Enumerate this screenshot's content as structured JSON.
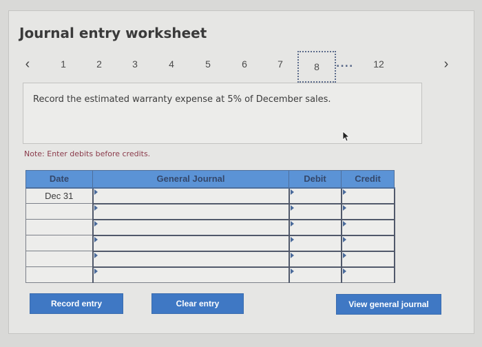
{
  "title": "Journal entry worksheet",
  "pager": {
    "prev_icon": "‹",
    "next_icon": "›",
    "pages": [
      "1",
      "2",
      "3",
      "4",
      "5",
      "6",
      "7",
      "8"
    ],
    "active_page": "8",
    "ellipsis": "....",
    "last_page": "12"
  },
  "prompt": "Record the estimated warranty expense at 5% of December sales.",
  "note": "Note: Enter debits before credits.",
  "table": {
    "headers": {
      "date": "Date",
      "journal": "General Journal",
      "debit": "Debit",
      "credit": "Credit"
    },
    "rows": [
      {
        "date": "Dec 31",
        "account": "",
        "debit": "",
        "credit": ""
      },
      {
        "date": "",
        "account": "",
        "debit": "",
        "credit": ""
      },
      {
        "date": "",
        "account": "",
        "debit": "",
        "credit": ""
      },
      {
        "date": "",
        "account": "",
        "debit": "",
        "credit": ""
      },
      {
        "date": "",
        "account": "",
        "debit": "",
        "credit": ""
      },
      {
        "date": "",
        "account": "",
        "debit": "",
        "credit": ""
      }
    ]
  },
  "buttons": {
    "record": "Record entry",
    "clear": "Clear entry",
    "view": "View general journal"
  },
  "colors": {
    "header_blue": "#5b93d6",
    "button_blue": "#3f78c4",
    "note_red": "#8a3a4a"
  }
}
